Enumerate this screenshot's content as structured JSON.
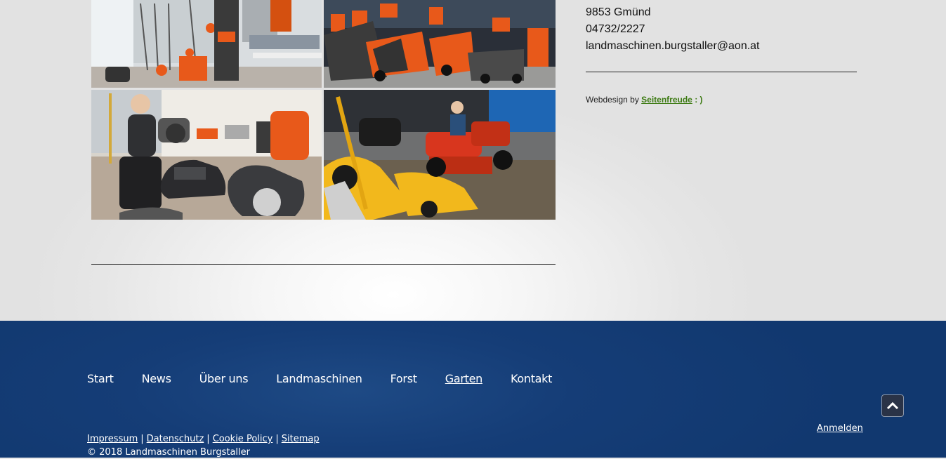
{
  "contact": {
    "city": "9853 Gmünd",
    "phone": "04732/2227",
    "email": "landmaschinen.burgstaller@aon.at"
  },
  "credit": {
    "prefix": "Webdesign by",
    "link": "Seitenfreude",
    "suffix": ": )"
  },
  "footer": {
    "nav": [
      "Start",
      "News",
      "Über uns",
      "Landmaschinen",
      "Forst",
      "Garten",
      "Kontakt"
    ],
    "active_nav": "Garten",
    "login": "Anmelden",
    "legal_links": [
      "Impressum",
      "Datenschutz",
      "Cookie Policy",
      "Sitemap"
    ],
    "separator": "|",
    "copyright": "© 2018 Landmaschinen Burgstaller"
  },
  "icons": {
    "scroll_top": "chevron-up-icon"
  },
  "colors": {
    "footer_bg": "#153d77",
    "credit_link": "#3c7a12",
    "husqvarna_orange": "#e8591a",
    "stiga_yellow": "#f2b81c"
  }
}
